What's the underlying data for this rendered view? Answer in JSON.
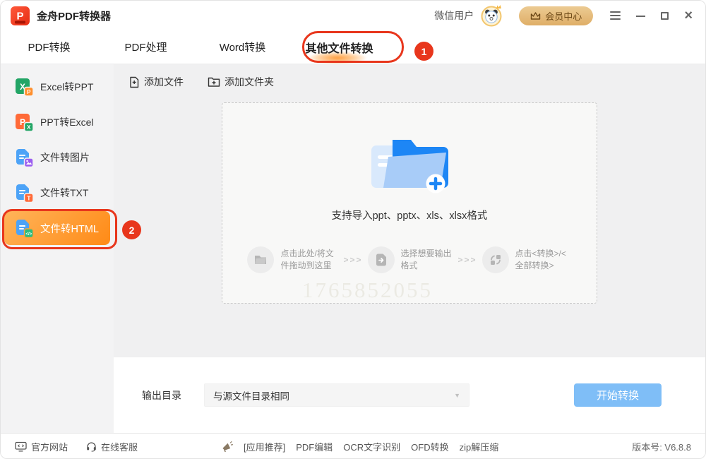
{
  "titlebar": {
    "app_title": "金舟PDF转换器",
    "user_label": "微信用户",
    "member_center": "会员中心"
  },
  "tabs": {
    "items": [
      {
        "label": "PDF转换"
      },
      {
        "label": "PDF处理"
      },
      {
        "label": "Word转换"
      },
      {
        "label": "其他文件转换"
      }
    ]
  },
  "annotations": {
    "badge1": "1",
    "badge2": "2"
  },
  "sidebar": {
    "items": [
      {
        "label": "Excel转PPT"
      },
      {
        "label": "PPT转Excel"
      },
      {
        "label": "文件转图片"
      },
      {
        "label": "文件转TXT"
      },
      {
        "label": "文件转HTML"
      }
    ]
  },
  "toolbar": {
    "add_file": "添加文件",
    "add_folder": "添加文件夹"
  },
  "dropzone": {
    "support_text": "支持导入ppt、pptx、xls、xlsx格式",
    "watermark": "1765852055",
    "arrow_separator": ">>>",
    "steps": [
      {
        "text": "点击此处/将文件拖动到这里"
      },
      {
        "text": "选择想要输出格式"
      },
      {
        "text": "点击<转换>/<全部转换>"
      }
    ]
  },
  "output": {
    "label": "输出目录",
    "directory_value": "与源文件目录相同",
    "start_button": "开始转换"
  },
  "footer": {
    "website": "官方网站",
    "support": "在线客服",
    "recommend_tag": "[应用推荐]",
    "links": [
      {
        "label": "PDF编辑"
      },
      {
        "label": "OCR文字识别"
      },
      {
        "label": "OFD转换"
      },
      {
        "label": "zip解压缩"
      }
    ],
    "version": "版本号: V6.8.8"
  },
  "colors": {
    "annotation_red": "#e8361c",
    "active_orange": "#ff8a16",
    "primary_blue": "#7fbef7",
    "member_gold": "#dfae67"
  }
}
